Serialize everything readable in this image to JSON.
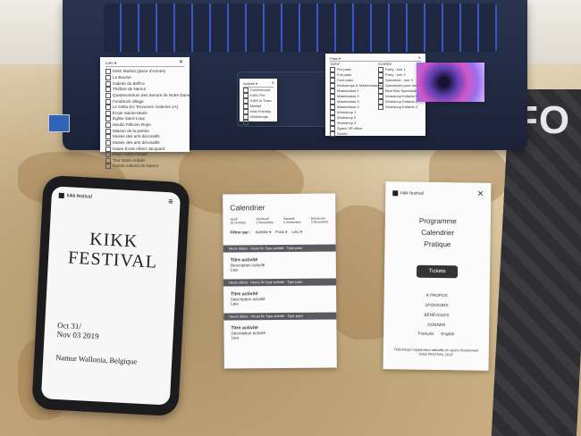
{
  "menu_lieu": {
    "title": "Lieu",
    "close": "✕",
    "items": [
      "KIKK Market (place d'Armes)",
      "La Bourse",
      "Galerie du Beffroi",
      "Théâtre de Namur",
      "Quatrecentrum des Soeurs de Notre Dame",
      "Foodtruck village",
      "Le Delta (ex Tervueren Galeries 1A)",
      "École Sainte-Marie",
      "Église Saint-Loup",
      "Moulin Félicien Rops",
      "Maison de la poésie",
      "Musée des arts décoratifs",
      "Musée des arts décoratifs",
      "Haute École Albert Jacquard",
      "Place Saint-Aubain",
      "Tour Saint-Aubain",
      "Centre culturel de Namur"
    ]
  },
  "menu_activite": {
    "title": "Activité",
    "close": "✕",
    "items": [
      "Conférences",
      "KIKK Pro",
      "KIKK in Town",
      "Market",
      "Kids Friendly",
      "Workshops",
      "Soirées"
    ]
  },
  "menu_pass": {
    "title": "Pass",
    "close": "✕",
    "col1_header": "TARIF",
    "col1": [
      "Pro pass",
      "Full pass",
      "Conf pass",
      "Workshops & Masterclasses",
      "Masterclass 1",
      "Masterclass 2",
      "Masterclass 3",
      "Masterclass 4",
      "Workshop 1",
      "Workshop 2",
      "Workshop 3",
      "Spack VR office",
      "Soirée"
    ],
    "col2_header": "SOIRÉE",
    "col2": [
      "Party - soir 1",
      "Party - soir 2",
      "Spectacle - soir 3",
      "Spectacles pour enfants",
      "Blue Bird Spectacle pour enfants",
      "Workshop Enfants 1",
      "Workshop Enfants 2",
      "Workshop Enfants 3"
    ]
  },
  "phone": {
    "brand": "kikk festival",
    "title_line1": "KIKK",
    "title_line2": "FESTIVAL",
    "dates_line1": "Oct 31/",
    "dates_line2": "Nov 03 2019",
    "location": "Namur Wallonia, Belgique"
  },
  "calendar": {
    "title": "Calendrier",
    "days": [
      {
        "name": "Jeudi",
        "date": "31 Octobre"
      },
      {
        "name": "Vendredi",
        "date": "1 Novembre"
      },
      {
        "name": "Samedi",
        "date": "2 Novembre"
      },
      {
        "name": "Dimanche",
        "date": "3 Novembre"
      }
    ],
    "filter_label": "Filtrer par :",
    "filters": [
      "Activité ▾",
      "Pass ▾",
      "Lieu ▾"
    ],
    "events": [
      {
        "bar": "Heure début - Heure fin   Type activité · Type pass",
        "title": "Titre activité",
        "desc": "Description activité",
        "place": "Lieu"
      },
      {
        "bar": "Heure début - Heure fin   Type activité · Type pass",
        "title": "Titre activité",
        "desc": "Description activité",
        "place": "Lieu"
      },
      {
        "bar": "Heure début - Heure fin   Type activité · Type pass",
        "title": "Titre activité",
        "desc": "Description activité",
        "place": "Lieu"
      }
    ]
  },
  "menu_card": {
    "brand": "kikk festival",
    "close": "✕",
    "nav": [
      "Programme",
      "Calendrier",
      "Pratique"
    ],
    "button": "Tickets",
    "links": [
      "À PROPOS",
      "SPONSORS",
      "BÉNÉVOLES",
      "DONNER"
    ],
    "languages": [
      "Français",
      "English"
    ],
    "footer": "Télécharger l'application attendify et rejoins l'évènement \"KIKK FESTIVAL 2019\""
  },
  "fabric_text": "FO",
  "colors": {
    "map_paper": "#cdb48a",
    "laptop": "#1b2238",
    "key_glow": "#3d5bd0",
    "dark_bar": "#5a5a62"
  }
}
